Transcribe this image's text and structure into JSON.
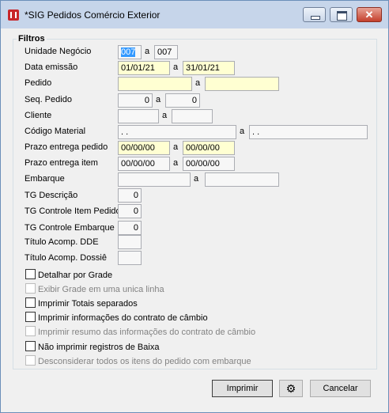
{
  "window": {
    "title": "*SIG Pedidos Comércio Exterior",
    "controls": {
      "min": "",
      "max": "",
      "close": "✕"
    }
  },
  "filters": {
    "group_title": "Filtros",
    "unidade_negocio": {
      "label": "Unidade Negócio",
      "from": "007",
      "sep": "a",
      "to": "007"
    },
    "data_emissao": {
      "label": "Data emissão",
      "from": "01/01/21",
      "sep": "a",
      "to": "31/01/21"
    },
    "pedido": {
      "label": "Pedido",
      "from": "",
      "sep": "a",
      "to": ""
    },
    "seq_pedido": {
      "label": "Seq. Pedido",
      "from": "0",
      "sep": "a",
      "to": "0"
    },
    "cliente": {
      "label": "Cliente",
      "from": "",
      "sep": "a",
      "to": ""
    },
    "codigo_material": {
      "label": "Código Material",
      "from": ". .",
      "sep": "a",
      "to": ". ."
    },
    "prazo_entrega_pedido": {
      "label": "Prazo entrega pedido",
      "from": "00/00/00",
      "sep": "a",
      "to": "00/00/00"
    },
    "prazo_entrega_item": {
      "label": "Prazo entrega item",
      "from": "00/00/00",
      "sep": "a",
      "to": "00/00/00"
    },
    "embarque": {
      "label": "Embarque",
      "from": "",
      "sep": "a",
      "to": ""
    },
    "tg_descricao": {
      "label": "TG Descrição",
      "value": "0"
    },
    "tg_controle_item_pedido": {
      "label": "TG Controle Item Pedido",
      "value": "0"
    },
    "tg_controle_embarque": {
      "label": "TG Controle Embarque",
      "value": "0"
    },
    "titulo_acomp_dde": {
      "label": "Título Acomp. DDE",
      "value": ""
    },
    "titulo_acomp_dossie": {
      "label": "Título Acomp. Dossiê",
      "value": ""
    }
  },
  "options": [
    {
      "label": "Detalhar por Grade",
      "enabled": true,
      "checked": false
    },
    {
      "label": "Exibir Grade em uma unica linha",
      "enabled": false,
      "checked": false
    },
    {
      "label": "Imprimir Totais separados",
      "enabled": true,
      "checked": false
    },
    {
      "label": "Imprimir informações do contrato de câmbio",
      "enabled": true,
      "checked": false
    },
    {
      "label": "Imprimir resumo das informações do contrato de câmbio",
      "enabled": false,
      "checked": false
    },
    {
      "label": "Não imprimir registros de Baixa",
      "enabled": true,
      "checked": false
    },
    {
      "label": "Desconsiderar todos os itens do pedido com embarque",
      "enabled": false,
      "checked": false
    }
  ],
  "buttons": {
    "imprimir": "Imprimir",
    "settings_icon": "gear-icon",
    "cancelar": "Cancelar"
  }
}
